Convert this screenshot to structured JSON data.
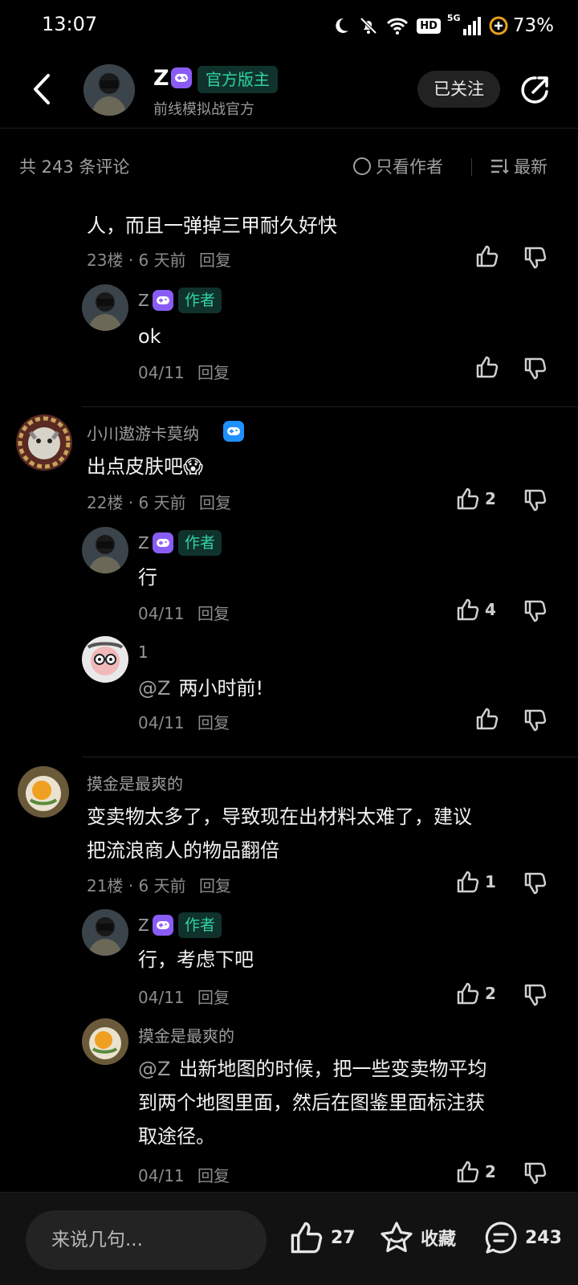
{
  "status": {
    "time": "13:07",
    "battery": "73%",
    "network": "5G",
    "hd": "HD"
  },
  "header": {
    "author_name": "Z",
    "official_tag": "官方版主",
    "subtitle": "前线模拟战官方",
    "follow_label": "已关注"
  },
  "comments_bar": {
    "count_text": "共 243 条评论",
    "author_only_label": "只看作者",
    "sort_label": "最新"
  },
  "comments": [
    {
      "partial_text": "人，而且一弹掉三甲耐久好快",
      "floor": "23楼",
      "time": "· 6 天前",
      "reply_label": "回复",
      "like_count": "",
      "replies": [
        {
          "user": "Z",
          "tag": "作者",
          "text": "ok",
          "date": "04/11",
          "reply_label": "回复",
          "like_count": ""
        }
      ]
    },
    {
      "user": "小川遨游卡莫纳",
      "text": "出点皮肤吧😱",
      "floor": "22楼",
      "time": "· 6 天前",
      "reply_label": "回复",
      "like_count": "2",
      "replies": [
        {
          "user": "Z",
          "tag": "作者",
          "text": "行",
          "date": "04/11",
          "reply_label": "回复",
          "like_count": "4"
        },
        {
          "user": "1",
          "mention": "@Z",
          "text": "两小时前!",
          "date": "04/11",
          "reply_label": "回复",
          "like_count": ""
        }
      ]
    },
    {
      "user": "摸金是最爽的",
      "text_line1": "变卖物太多了，导致现在出材料太难了，建议",
      "text_line2": "把流浪商人的物品翻倍",
      "floor": "21楼",
      "time": "· 6 天前",
      "reply_label": "回复",
      "like_count": "1",
      "replies": [
        {
          "user": "Z",
          "tag": "作者",
          "text": "行，考虑下吧",
          "date": "04/11",
          "reply_label": "回复",
          "like_count": "2"
        },
        {
          "user": "摸金是最爽的",
          "mention": "@Z",
          "text_line1": "出新地图的时候，把一些变卖物平均",
          "text_line2": "到两个地图里面，然后在图鉴里面标注获",
          "text_line3": "取途径。",
          "date": "04/11",
          "reply_label": "回复",
          "like_count": "2"
        }
      ]
    }
  ],
  "bottom_bar": {
    "input_placeholder": "来说几句...",
    "like_count": "27",
    "collect_label": "收藏",
    "comment_count": "243"
  },
  "colors": {
    "background": "#000000",
    "accent_green": "#2fd3a6",
    "badge_purple": "#8a5cf6",
    "badge_blue": "#1e90ff"
  }
}
